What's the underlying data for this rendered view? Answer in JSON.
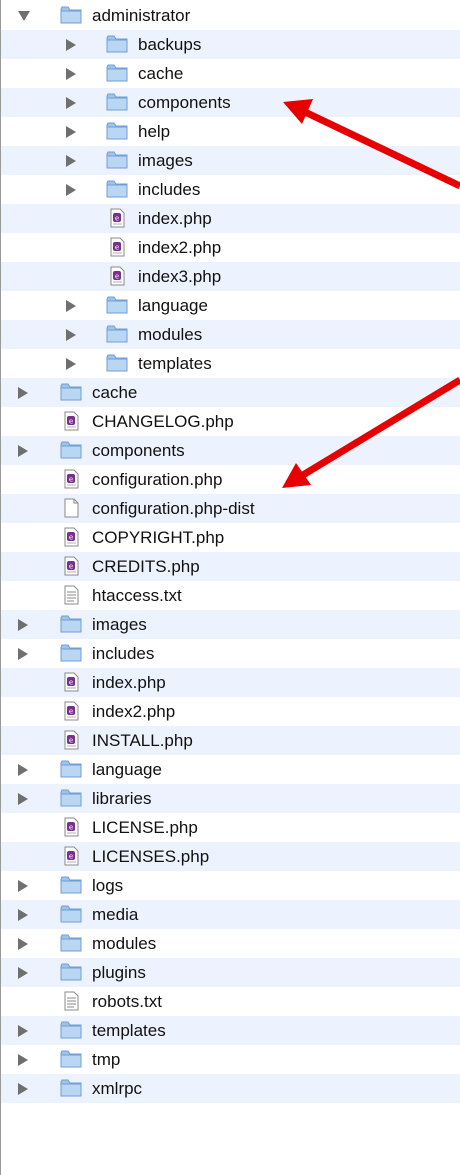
{
  "colors": {
    "alt_row": "#edf3fe",
    "folder": "#9fc3e9",
    "arrow": "#e60000"
  },
  "icons": {
    "folder": "folder-icon",
    "php": "php-file-icon",
    "blank": "blank-file-icon",
    "text": "text-file-icon"
  },
  "tree": [
    {
      "label": "administrator",
      "depth": 0,
      "kind": "folder",
      "disclosure": "open"
    },
    {
      "label": "backups",
      "depth": 1,
      "kind": "folder",
      "disclosure": "closed"
    },
    {
      "label": "cache",
      "depth": 1,
      "kind": "folder",
      "disclosure": "closed"
    },
    {
      "label": "components",
      "depth": 1,
      "kind": "folder",
      "disclosure": "closed"
    },
    {
      "label": "help",
      "depth": 1,
      "kind": "folder",
      "disclosure": "closed"
    },
    {
      "label": "images",
      "depth": 1,
      "kind": "folder",
      "disclosure": "closed"
    },
    {
      "label": "includes",
      "depth": 1,
      "kind": "folder",
      "disclosure": "closed"
    },
    {
      "label": "index.php",
      "depth": 1,
      "kind": "php",
      "disclosure": "none"
    },
    {
      "label": "index2.php",
      "depth": 1,
      "kind": "php",
      "disclosure": "none"
    },
    {
      "label": "index3.php",
      "depth": 1,
      "kind": "php",
      "disclosure": "none"
    },
    {
      "label": "language",
      "depth": 1,
      "kind": "folder",
      "disclosure": "closed"
    },
    {
      "label": "modules",
      "depth": 1,
      "kind": "folder",
      "disclosure": "closed"
    },
    {
      "label": "templates",
      "depth": 1,
      "kind": "folder",
      "disclosure": "closed"
    },
    {
      "label": "cache",
      "depth": 0,
      "kind": "folder",
      "disclosure": "closed"
    },
    {
      "label": "CHANGELOG.php",
      "depth": 0,
      "kind": "php",
      "disclosure": "none"
    },
    {
      "label": "components",
      "depth": 0,
      "kind": "folder",
      "disclosure": "closed"
    },
    {
      "label": "configuration.php",
      "depth": 0,
      "kind": "php",
      "disclosure": "none"
    },
    {
      "label": "configuration.php-dist",
      "depth": 0,
      "kind": "blank",
      "disclosure": "none"
    },
    {
      "label": "COPYRIGHT.php",
      "depth": 0,
      "kind": "php",
      "disclosure": "none"
    },
    {
      "label": "CREDITS.php",
      "depth": 0,
      "kind": "php",
      "disclosure": "none"
    },
    {
      "label": "htaccess.txt",
      "depth": 0,
      "kind": "text",
      "disclosure": "none"
    },
    {
      "label": "images",
      "depth": 0,
      "kind": "folder",
      "disclosure": "closed"
    },
    {
      "label": "includes",
      "depth": 0,
      "kind": "folder",
      "disclosure": "closed"
    },
    {
      "label": "index.php",
      "depth": 0,
      "kind": "php",
      "disclosure": "none"
    },
    {
      "label": "index2.php",
      "depth": 0,
      "kind": "php",
      "disclosure": "none"
    },
    {
      "label": "INSTALL.php",
      "depth": 0,
      "kind": "php",
      "disclosure": "none"
    },
    {
      "label": "language",
      "depth": 0,
      "kind": "folder",
      "disclosure": "closed"
    },
    {
      "label": "libraries",
      "depth": 0,
      "kind": "folder",
      "disclosure": "closed"
    },
    {
      "label": "LICENSE.php",
      "depth": 0,
      "kind": "php",
      "disclosure": "none"
    },
    {
      "label": "LICENSES.php",
      "depth": 0,
      "kind": "php",
      "disclosure": "none"
    },
    {
      "label": "logs",
      "depth": 0,
      "kind": "folder",
      "disclosure": "closed"
    },
    {
      "label": "media",
      "depth": 0,
      "kind": "folder",
      "disclosure": "closed"
    },
    {
      "label": "modules",
      "depth": 0,
      "kind": "folder",
      "disclosure": "closed"
    },
    {
      "label": "plugins",
      "depth": 0,
      "kind": "folder",
      "disclosure": "closed"
    },
    {
      "label": "robots.txt",
      "depth": 0,
      "kind": "text",
      "disclosure": "none"
    },
    {
      "label": "templates",
      "depth": 0,
      "kind": "folder",
      "disclosure": "closed"
    },
    {
      "label": "tmp",
      "depth": 0,
      "kind": "folder",
      "disclosure": "closed"
    },
    {
      "label": "xmlrpc",
      "depth": 0,
      "kind": "folder",
      "disclosure": "closed"
    }
  ]
}
